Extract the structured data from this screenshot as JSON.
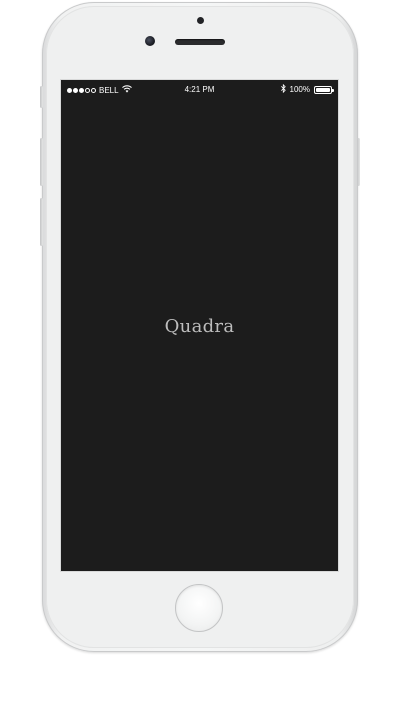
{
  "status_bar": {
    "carrier": "BELL",
    "time": "4:21 PM",
    "battery_text": "100%",
    "battery_level": 1.0,
    "signal_strength": 3,
    "signal_max": 5,
    "icons": [
      "signal-dots-icon",
      "wifi-icon",
      "bluetooth-icon",
      "battery-icon"
    ]
  },
  "app": {
    "title": "Quadra",
    "background_color": "#1c1c1c",
    "title_color": "#bdbdbd"
  },
  "device": {
    "body_color": "#f5f6f6"
  }
}
